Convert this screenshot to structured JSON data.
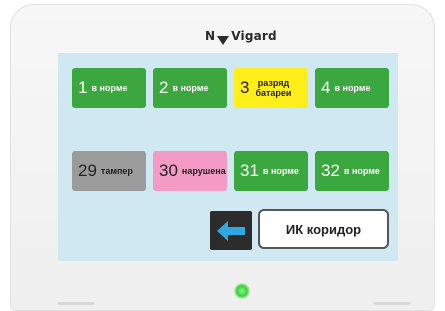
{
  "brand": {
    "logo_text_left": "N",
    "logo_text_right": "Vigard"
  },
  "zones": [
    {
      "number": "1",
      "status": "в норме",
      "state": "ok"
    },
    {
      "number": "2",
      "status": "в норме",
      "state": "ok"
    },
    {
      "number": "3",
      "status": "разряд батареи",
      "state": "warn"
    },
    {
      "number": "4",
      "status": "в норме",
      "state": "ok"
    },
    {
      "number": "29",
      "status": "тампер",
      "state": "tamper"
    },
    {
      "number": "30",
      "status": "нарушена",
      "state": "viol"
    },
    {
      "number": "31",
      "status": "в норме",
      "state": "ok"
    },
    {
      "number": "32",
      "status": "в норме",
      "state": "ok"
    }
  ],
  "controls": {
    "back_icon": "arrow-left-icon",
    "ir_label": "ИК коридор"
  },
  "colors": {
    "ok": "#3aa83f",
    "warn": "#ffee1a",
    "tamper": "#9b9b9b",
    "violation": "#f39bc4",
    "screen": "#cfe8f1",
    "back_arrow": "#2fa7e0"
  }
}
